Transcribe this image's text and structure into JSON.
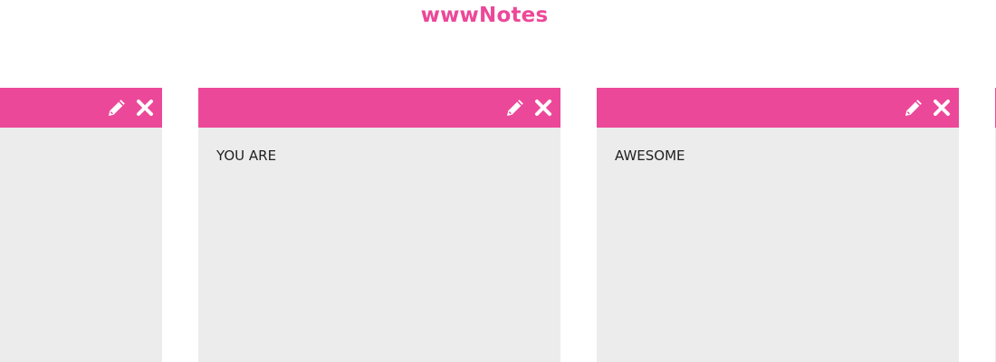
{
  "app": {
    "title": "wwwNotes"
  },
  "notes": [
    {
      "text": ""
    },
    {
      "text": "YOU ARE"
    },
    {
      "text": "AWESOME"
    },
    {
      "text": ""
    }
  ],
  "colors": {
    "accent": "#ec4899",
    "note_background": "#ececec",
    "icon": "#ffffff"
  },
  "icons": {
    "edit": "pencil-icon",
    "delete": "close-icon"
  }
}
